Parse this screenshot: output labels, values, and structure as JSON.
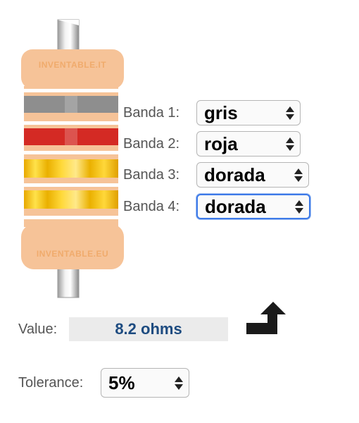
{
  "resistor": {
    "logo_top": "INVENTABLE.IT",
    "logo_bottom": "INVENTABLE.EU",
    "band_colors": [
      "#8e8e8e",
      "#d42a24",
      "#f5c21a",
      "#f5c21a"
    ]
  },
  "bands": [
    {
      "label": "Banda 1:",
      "value": "gris"
    },
    {
      "label": "Banda 2:",
      "value": "roja"
    },
    {
      "label": "Banda 3:",
      "value": "dorada"
    },
    {
      "label": "Banda 4:",
      "value": "dorada"
    }
  ],
  "result": {
    "label": "Value:",
    "value": "8.2 ohms"
  },
  "tolerance": {
    "label": "Tolerance:",
    "value": "5%"
  },
  "update_button": {
    "icon": "arrow-turn-up-icon"
  }
}
